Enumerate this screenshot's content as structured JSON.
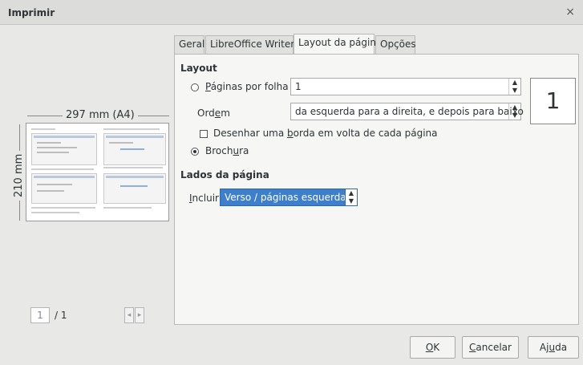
{
  "window": {
    "title": "Imprimir",
    "close_glyph": "×"
  },
  "preview": {
    "width_label": "297 mm (A4)",
    "height_label": "210 mm",
    "page_current": "1",
    "page_total": "/ 1",
    "prev_glyph": "◂",
    "next_glyph": "▸"
  },
  "tabs": [
    {
      "label": "Geral"
    },
    {
      "label": "LibreOffice Writer"
    },
    {
      "label": "Layout da página"
    },
    {
      "label": "Opções"
    }
  ],
  "layout": {
    "heading": "Layout",
    "pages_per_sheet": {
      "label_pre": "",
      "label_accel": "P",
      "label_post": "áginas por folha",
      "value": "1"
    },
    "order": {
      "label_pre": "Ord",
      "label_accel": "e",
      "label_post": "m",
      "value": "da esquerda para a direita, e depois para baixo"
    },
    "border": {
      "label_pre": "Desenhar uma ",
      "label_accel": "b",
      "label_post": "orda em volta de cada página"
    },
    "brochure": {
      "label_pre": "Broch",
      "label_accel": "u",
      "label_post": "ra"
    },
    "preview_number": "1"
  },
  "sides": {
    "heading": "Lados da página",
    "include_pre": "",
    "include_accel": "I",
    "include_post": "ncluir",
    "include_value": "Verso / páginas esquerdas"
  },
  "buttons": {
    "ok_accel": "O",
    "ok_post": "K",
    "cancel_accel": "C",
    "cancel_post": "ancelar",
    "help_pre": "Aj",
    "help_accel": "u",
    "help_post": "da"
  },
  "icons": {
    "spin": "▲▼"
  }
}
